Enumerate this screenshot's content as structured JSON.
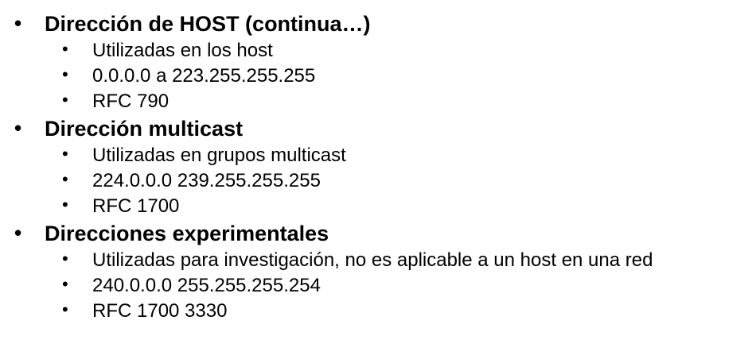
{
  "sections": [
    {
      "heading": "Dirección de HOST (continua…)",
      "items": [
        "Utilizadas en los host",
        "0.0.0.0 a 223.255.255.255",
        "RFC 790"
      ]
    },
    {
      "heading": "Dirección multicast",
      "items": [
        "Utilizadas en grupos multicast",
        "224.0.0.0 239.255.255.255",
        "RFC 1700"
      ]
    },
    {
      "heading": "Direcciones experimentales",
      "items": [
        "Utilizadas para investigación, no es aplicable a un host en una red",
        "240.0.0.0 255.255.255.254",
        "RFC 1700 3330"
      ]
    }
  ],
  "bullet_symbol": "•"
}
